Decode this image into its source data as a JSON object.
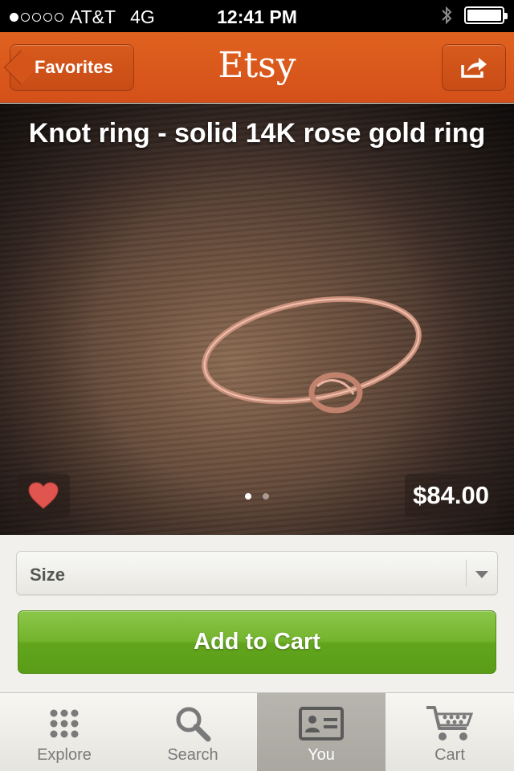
{
  "status_bar": {
    "carrier": "AT&T",
    "network": "4G",
    "time": "12:41 PM",
    "signal_bars_filled": 1,
    "signal_bars_total": 5,
    "battery_level": 1.0
  },
  "navbar": {
    "back_label": "Favorites",
    "logo_text": "Etsy",
    "share_icon": "share-icon"
  },
  "listing": {
    "title": "Knot ring - solid 14K rose gold ring",
    "price": "$84.00",
    "favorited": true,
    "image_count": 2,
    "current_image": 1
  },
  "size_select": {
    "label": "Size"
  },
  "add_to_cart": {
    "label": "Add to Cart"
  },
  "tabbar": {
    "tabs": [
      {
        "label": "Explore",
        "icon": "explore-grid-icon",
        "active": false
      },
      {
        "label": "Search",
        "icon": "magnifier-icon",
        "active": false
      },
      {
        "label": "You",
        "icon": "profile-card-icon",
        "active": true
      },
      {
        "label": "Cart",
        "icon": "cart-icon",
        "active": false
      }
    ]
  },
  "colors": {
    "navbar": "#d9561b",
    "add_to_cart": "#6fb02a",
    "heart": "#e0554f"
  }
}
